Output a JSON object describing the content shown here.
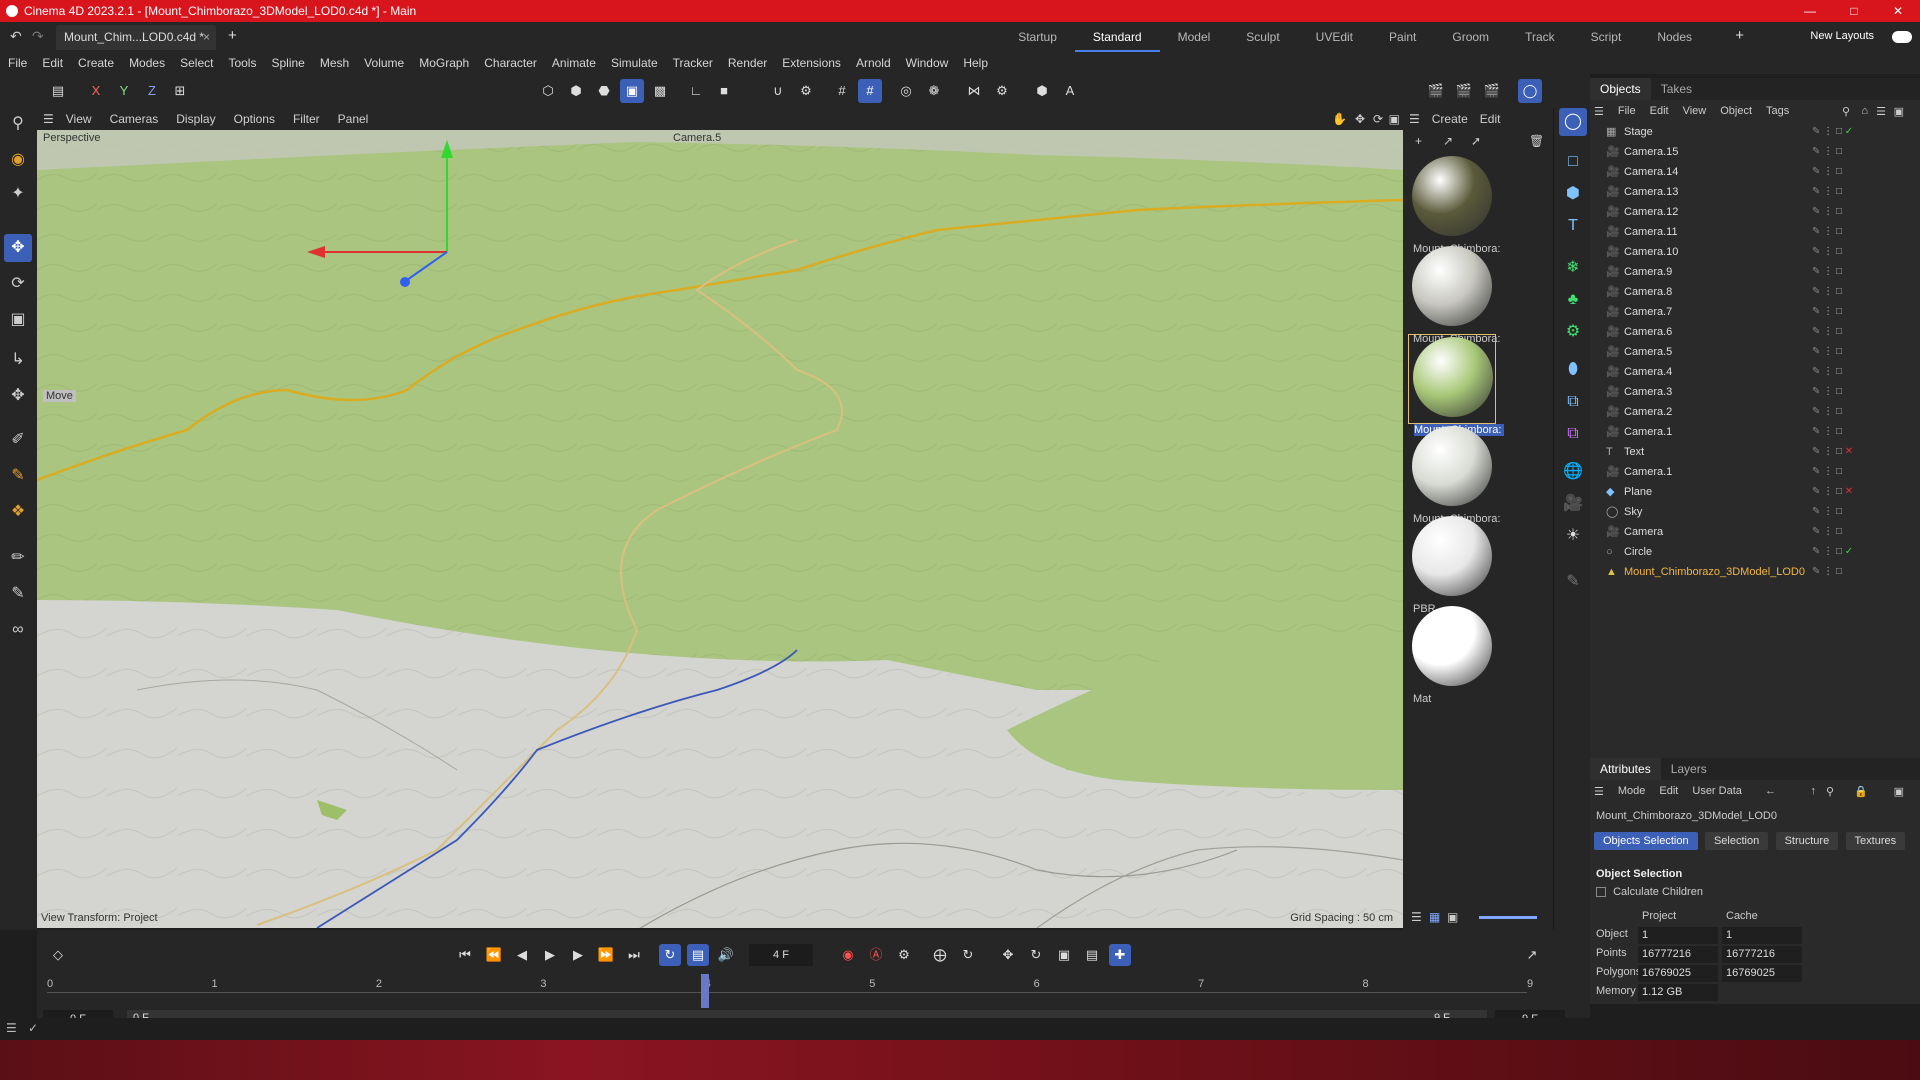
{
  "window": {
    "title": "Cinema 4D 2023.2.1 - [Mount_Chimborazo_3DModel_LOD0.c4d *] - Main"
  },
  "document_tab": {
    "label": "Mount_Chim...LOD0.c4d *",
    "close": "×",
    "add": "+"
  },
  "layouts": {
    "items": [
      "Startup",
      "Standard",
      "Model",
      "Sculpt",
      "UVEdit",
      "Paint",
      "Groom",
      "Track",
      "Script",
      "Nodes"
    ],
    "active": "Standard",
    "new_layouts": "New Layouts"
  },
  "menu": [
    "File",
    "Edit",
    "Create",
    "Modes",
    "Select",
    "Tools",
    "Spline",
    "Mesh",
    "Volume",
    "MoGraph",
    "Character",
    "Animate",
    "Simulate",
    "Tracker",
    "Render",
    "Extensions",
    "Arnold",
    "Window",
    "Help"
  ],
  "axis_buttons": [
    "X",
    "Y",
    "Z"
  ],
  "viewport": {
    "menu": [
      "View",
      "Cameras",
      "Display",
      "Options",
      "Filter",
      "Panel"
    ],
    "projection": "Perspective",
    "camera": "Camera.5",
    "tool_label": "Move",
    "view_transform": "View Transform: Project",
    "grid_spacing": "Grid Spacing : 50 cm"
  },
  "materials": {
    "menu": [
      "Create",
      "Edit"
    ],
    "items": [
      {
        "name": "Mount_Chimbora:",
        "color": "#5a5a3a"
      },
      {
        "name": "Mount_Chimbora:",
        "color": "#c8c8c0"
      },
      {
        "name": "Mount_Chimbora:",
        "color": "#a8c878",
        "selected": true
      },
      {
        "name": "Mount_Chimbora:",
        "color": "#d8dcd4"
      },
      {
        "name": "PBR",
        "color": "#e8e8e8"
      },
      {
        "name": "Mat",
        "color": "#ffffff"
      }
    ]
  },
  "objects_panel": {
    "tabs": [
      "Objects",
      "Takes"
    ],
    "menu": [
      "File",
      "Edit",
      "View",
      "Object",
      "Tags"
    ],
    "items": [
      {
        "name": "Stage",
        "icon": "stage-icon"
      },
      {
        "name": "Camera.15",
        "icon": "camera-icon"
      },
      {
        "name": "Camera.14",
        "icon": "camera-icon"
      },
      {
        "name": "Camera.13",
        "icon": "camera-icon"
      },
      {
        "name": "Camera.12",
        "icon": "camera-icon"
      },
      {
        "name": "Camera.11",
        "icon": "camera-icon"
      },
      {
        "name": "Camera.10",
        "icon": "camera-icon"
      },
      {
        "name": "Camera.9",
        "icon": "camera-icon"
      },
      {
        "name": "Camera.8",
        "icon": "camera-icon"
      },
      {
        "name": "Camera.7",
        "icon": "camera-icon"
      },
      {
        "name": "Camera.6",
        "icon": "camera-icon"
      },
      {
        "name": "Camera.5",
        "icon": "camera-icon"
      },
      {
        "name": "Camera.4",
        "icon": "camera-icon"
      },
      {
        "name": "Camera.3",
        "icon": "camera-icon"
      },
      {
        "name": "Camera.2",
        "icon": "camera-icon"
      },
      {
        "name": "Camera.1",
        "icon": "camera-icon"
      },
      {
        "name": "Text",
        "icon": "text-icon"
      },
      {
        "name": "Camera.1",
        "icon": "camera-icon"
      },
      {
        "name": "Plane",
        "icon": "plane-icon"
      },
      {
        "name": "Sky",
        "icon": "sky-icon"
      },
      {
        "name": "Camera",
        "icon": "camera-icon"
      },
      {
        "name": "Circle",
        "icon": "circle-icon"
      },
      {
        "name": "Mount_Chimborazo_3DModel_LOD0",
        "icon": "polygon-object-icon",
        "highlight": true
      }
    ]
  },
  "attributes": {
    "tabs": [
      "Attributes",
      "Layers"
    ],
    "menu": [
      "Mode",
      "Edit",
      "User Data"
    ],
    "object_name": "Mount_Chimborazo_3DModel_LOD0",
    "subtabs": [
      "Objects Selection",
      "Selection",
      "Structure",
      "Textures"
    ],
    "section": "Object Selection",
    "calculate_children": "Calculate Children",
    "col_project": "Project",
    "col_cache": "Cache",
    "rows": [
      {
        "label": "Object",
        "project": "1",
        "cache": "1"
      },
      {
        "label": "Points",
        "project": "16777216",
        "cache": "16777216"
      },
      {
        "label": "Polygons",
        "project": "16769025",
        "cache": "16769025"
      },
      {
        "label": "Memory",
        "project": "1.12 GB",
        "cache": ""
      }
    ]
  },
  "timeline": {
    "current_frame": "4 F",
    "ticks": [
      "0",
      "1",
      "2",
      "3",
      "4",
      "5",
      "6",
      "7",
      "8",
      "9"
    ],
    "start_left": "0 F",
    "start_right": "0 F",
    "end_left": "9 F",
    "end_right": "9 F",
    "playhead_frame": 4
  },
  "colors": {
    "titlebar": "#d8141c",
    "accent": "#3c5fb8",
    "terrain_green": "#a9c47f",
    "terrain_grey": "#d6d6d2",
    "trail_yellow": "#e0b020",
    "river_blue": "#3050b0"
  }
}
